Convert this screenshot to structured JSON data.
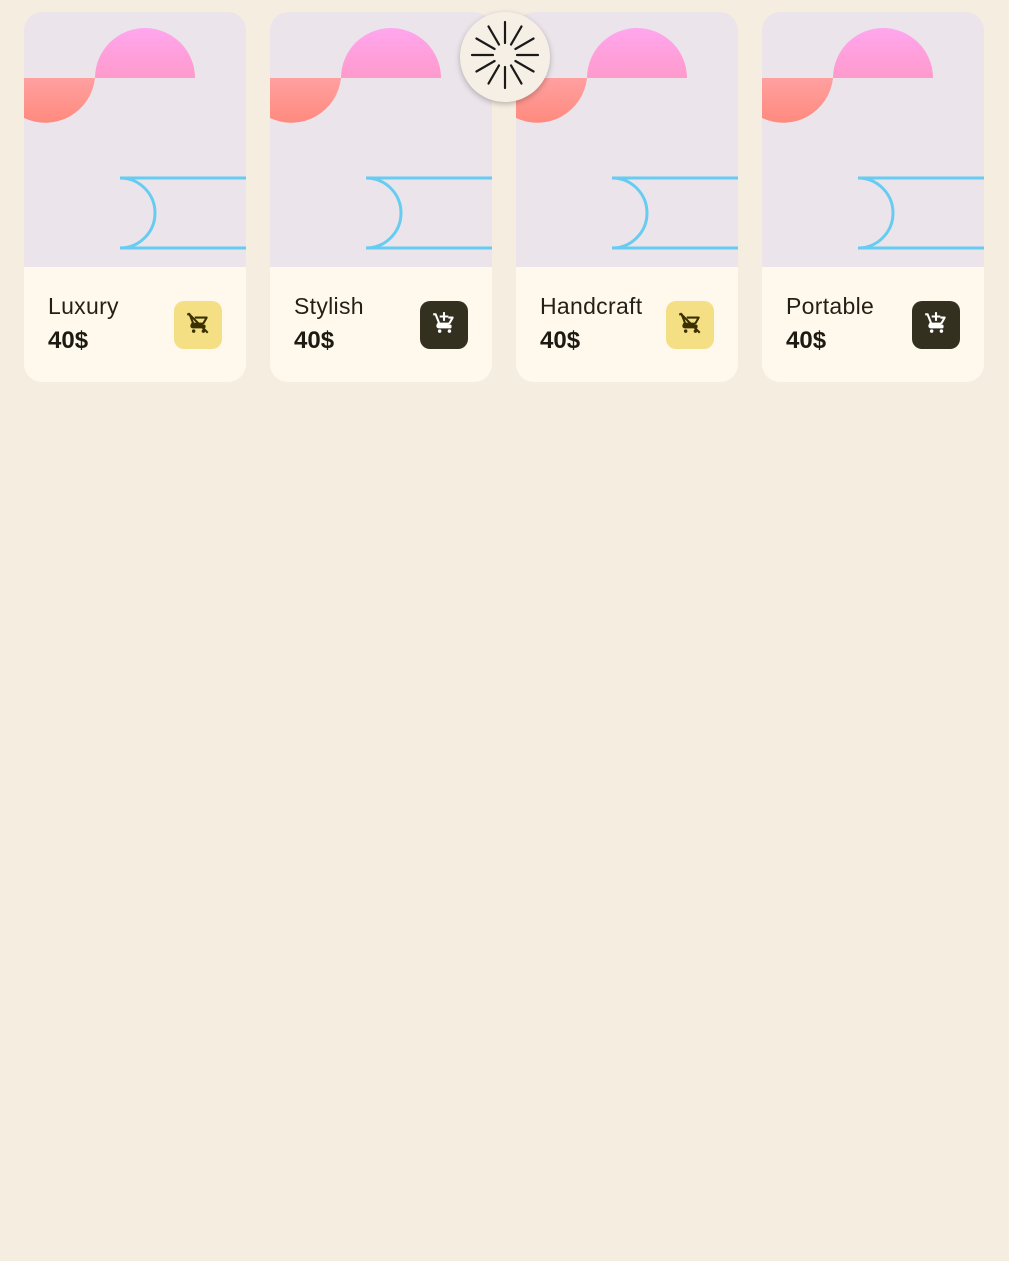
{
  "colors": {
    "page_bg": "#f5eddf",
    "card_bg": "#fff8ec",
    "art_bg": "#ebe4ea",
    "add_button": "#33301f",
    "remove_button": "#f5df85",
    "outline_shape": "#66ccf2"
  },
  "products": [
    {
      "name": "Luxury",
      "price": "40$",
      "cart_action": "remove",
      "icon": "remove-shopping-cart-icon"
    },
    {
      "name": "Stylish",
      "price": "40$",
      "cart_action": "add",
      "icon": "add-shopping-cart-icon"
    },
    {
      "name": "Handcraft",
      "price": "40$",
      "cart_action": "remove",
      "icon": "remove-shopping-cart-icon"
    },
    {
      "name": "Portable",
      "price": "40$",
      "cart_action": "add",
      "icon": "add-shopping-cart-icon"
    }
  ],
  "loading_indicator": {
    "icon": "spinner-icon"
  }
}
